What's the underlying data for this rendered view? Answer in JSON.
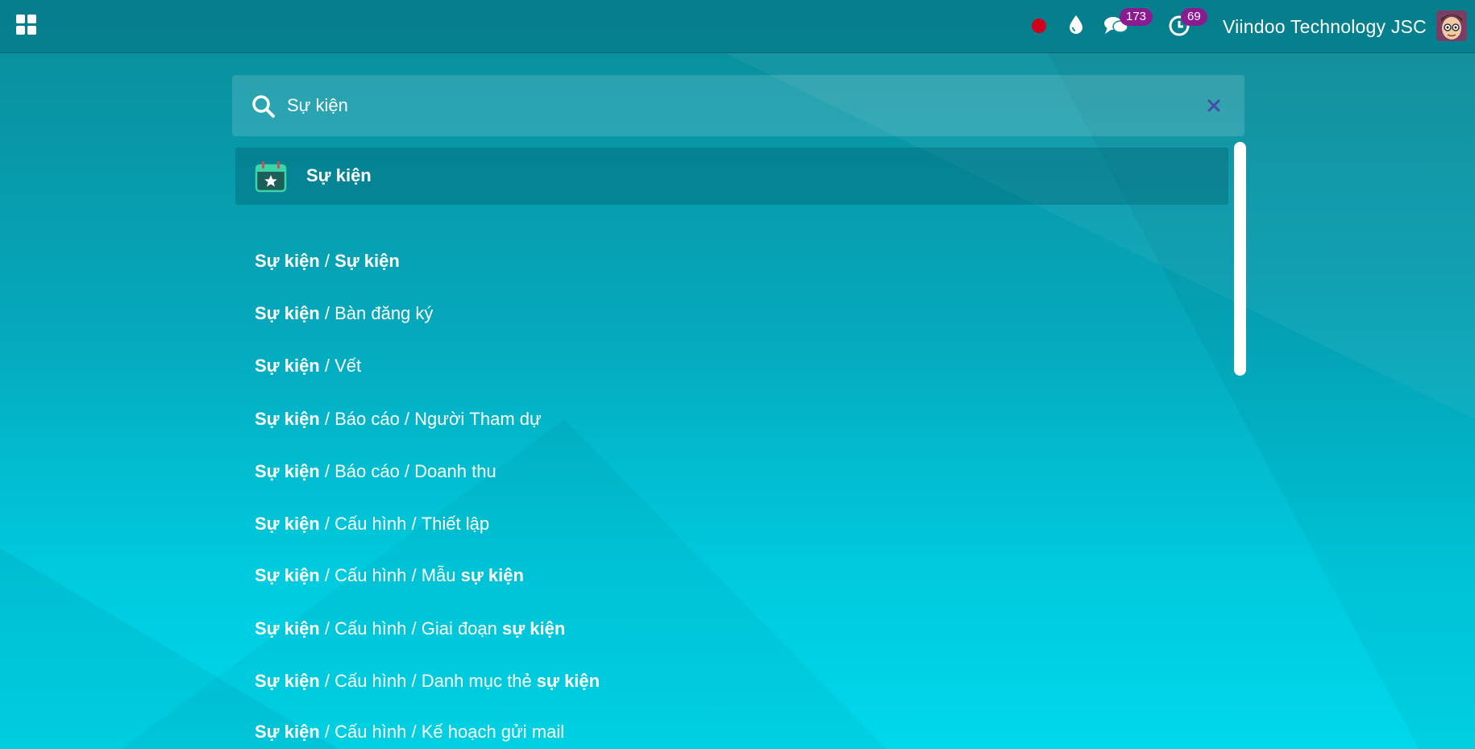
{
  "topbar": {
    "apps_icon": "apps-grid-icon",
    "record_icon": "record-dot-icon",
    "drop_icon": "water-drop-icon",
    "messages_icon": "chat-icon",
    "messages_count": "173",
    "activities_icon": "clock-icon",
    "activities_count": "69",
    "company": "Viindoo Technology JSC",
    "avatar_icon": "user-avatar-icon"
  },
  "search": {
    "value": "Sự kiện",
    "search_icon": "search-icon",
    "clear_icon": "close-icon"
  },
  "app_result": {
    "icon": "event-calendar-icon",
    "label": "Sự kiện"
  },
  "menu_results": [
    [
      {
        "t": "Sự kiện",
        "b": true
      },
      {
        "t": " / ",
        "b": false
      },
      {
        "t": "Sự kiện",
        "b": true
      }
    ],
    [
      {
        "t": "Sự kiện",
        "b": true
      },
      {
        "t": " / Bàn đăng ký",
        "b": false
      }
    ],
    [
      {
        "t": "Sự kiện",
        "b": true
      },
      {
        "t": " / Vết",
        "b": false
      }
    ],
    [
      {
        "t": "Sự kiện",
        "b": true
      },
      {
        "t": " / Báo cáo / Người Tham dự",
        "b": false
      }
    ],
    [
      {
        "t": "Sự kiện",
        "b": true
      },
      {
        "t": " / Báo cáo / Doanh thu",
        "b": false
      }
    ],
    [
      {
        "t": "Sự kiện",
        "b": true
      },
      {
        "t": " / Cấu hình / Thiết lập",
        "b": false
      }
    ],
    [
      {
        "t": "Sự kiện",
        "b": true
      },
      {
        "t": " / Cấu hình / Mẫu ",
        "b": false
      },
      {
        "t": "sự kiện",
        "b": true
      }
    ],
    [
      {
        "t": "Sự kiện",
        "b": true
      },
      {
        "t": " / Cấu hình / Giai đoạn ",
        "b": false
      },
      {
        "t": "sự kiện",
        "b": true
      }
    ],
    [
      {
        "t": "Sự kiện",
        "b": true
      },
      {
        "t": " / Cấu hình / Danh mục thẻ ",
        "b": false
      },
      {
        "t": "sự kiện",
        "b": true
      }
    ],
    [
      {
        "t": "Sự kiện",
        "b": true
      },
      {
        "t": " / Cấu hình / Kế hoạch gửi mail",
        "b": false
      }
    ]
  ],
  "colors": {
    "badge": "#8a1b91",
    "record_dot": "#d0021b",
    "accent_teal": "#00c9dd"
  }
}
